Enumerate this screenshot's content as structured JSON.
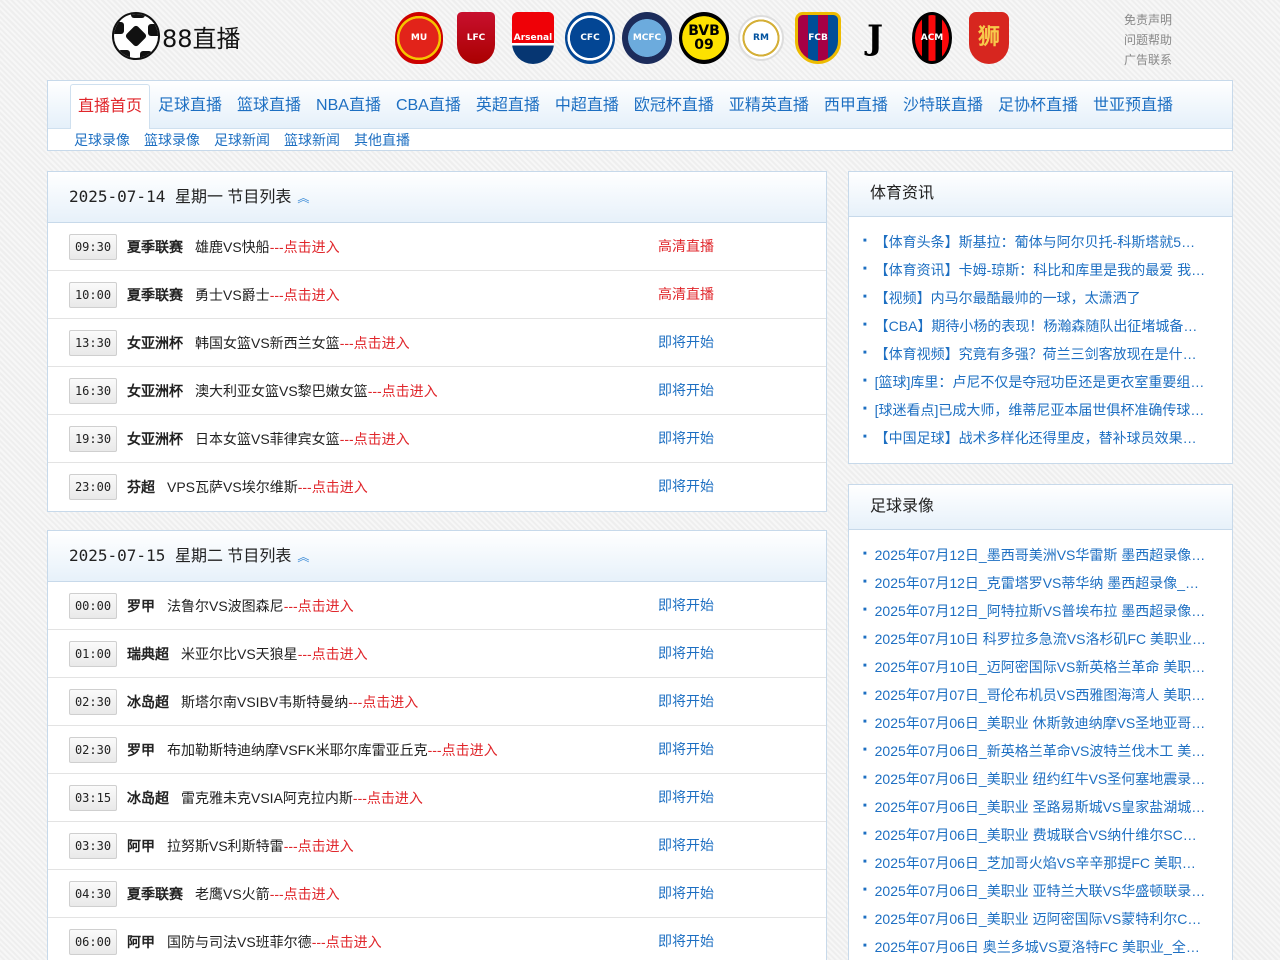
{
  "site": {
    "logo_text": "88直播"
  },
  "badges": [
    {
      "name": "manchester-united-crest-icon",
      "label": "MU",
      "cls": "c-mu"
    },
    {
      "name": "liverpool-crest-icon",
      "label": "LFC",
      "cls": "c-liv"
    },
    {
      "name": "arsenal-crest-icon",
      "label": "Arsenal",
      "cls": "c-ars"
    },
    {
      "name": "chelsea-crest-icon",
      "label": "CFC",
      "cls": "c-che"
    },
    {
      "name": "manchester-city-crest-icon",
      "label": "MCFC",
      "cls": "c-mci"
    },
    {
      "name": "dortmund-crest-icon",
      "label": "BVB 09",
      "cls": "c-bvb"
    },
    {
      "name": "real-madrid-crest-icon",
      "label": "RM",
      "cls": "c-rma"
    },
    {
      "name": "barcelona-crest-icon",
      "label": "FCB",
      "cls": "c-fcb"
    },
    {
      "name": "juventus-crest-icon",
      "label": "J",
      "cls": "c-juv"
    },
    {
      "name": "ac-milan-crest-icon",
      "label": "ACM",
      "cls": "c-mil"
    },
    {
      "name": "guangzhou-crest-icon",
      "label": "狮",
      "cls": "c-gz"
    }
  ],
  "toplinks": [
    "免责声明",
    "问题帮助",
    "广告联系"
  ],
  "nav": {
    "main": [
      "直播首页",
      "足球直播",
      "篮球直播",
      "NBA直播",
      "CBA直播",
      "英超直播",
      "中超直播",
      "欧冠杯直播",
      "亚精英直播",
      "西甲直播",
      "沙特联直播",
      "足协杯直播",
      "世亚预直播"
    ],
    "sub": [
      "足球录像",
      "篮球录像",
      "足球新闻",
      "篮球新闻",
      "其他直播"
    ]
  },
  "schedules": [
    {
      "date": "2025-07-14",
      "weekday": "星期一 节目列表",
      "rows": [
        {
          "time": "09:30",
          "league": "夏季联赛",
          "match": "雄鹿VS快船",
          "enter": "---点击进入",
          "status": "高清直播",
          "live": true
        },
        {
          "time": "10:00",
          "league": "夏季联赛",
          "match": "勇士VS爵士",
          "enter": "---点击进入",
          "status": "高清直播",
          "live": true
        },
        {
          "time": "13:30",
          "league": "女亚洲杯",
          "match": "韩国女篮VS新西兰女篮",
          "enter": "---点击进入",
          "status": "即将开始",
          "live": false
        },
        {
          "time": "16:30",
          "league": "女亚洲杯",
          "match": "澳大利亚女篮VS黎巴嫩女篮",
          "enter": "---点击进入",
          "status": "即将开始",
          "live": false
        },
        {
          "time": "19:30",
          "league": "女亚洲杯",
          "match": "日本女篮VS菲律宾女篮",
          "enter": "---点击进入",
          "status": "即将开始",
          "live": false
        },
        {
          "time": "23:00",
          "league": "芬超",
          "match": "VPS瓦萨VS埃尔维斯",
          "enter": "---点击进入",
          "status": "即将开始",
          "live": false
        }
      ]
    },
    {
      "date": "2025-07-15",
      "weekday": "星期二 节目列表",
      "rows": [
        {
          "time": "00:00",
          "league": "罗甲",
          "match": "法鲁尔VS波图森尼",
          "enter": "---点击进入",
          "status": "即将开始",
          "live": false
        },
        {
          "time": "01:00",
          "league": "瑞典超",
          "match": "米亚尔比VS天狼星",
          "enter": "---点击进入",
          "status": "即将开始",
          "live": false
        },
        {
          "time": "02:30",
          "league": "冰岛超",
          "match": "斯塔尔南VSIBV韦斯特曼纳",
          "enter": "---点击进入",
          "status": "即将开始",
          "live": false
        },
        {
          "time": "02:30",
          "league": "罗甲",
          "match": "布加勒斯特迪纳摩VSFK米耶尔库雷亚丘克",
          "enter": "---点击进入",
          "status": "即将开始",
          "live": false
        },
        {
          "time": "03:15",
          "league": "冰岛超",
          "match": "雷克雅未克VSIA阿克拉内斯",
          "enter": "---点击进入",
          "status": "即将开始",
          "live": false
        },
        {
          "time": "03:30",
          "league": "阿甲",
          "match": "拉努斯VS利斯特雷",
          "enter": "---点击进入",
          "status": "即将开始",
          "live": false
        },
        {
          "time": "04:30",
          "league": "夏季联赛",
          "match": "老鹰VS火箭",
          "enter": "---点击进入",
          "status": "即将开始",
          "live": false
        },
        {
          "time": "06:00",
          "league": "阿甲",
          "match": "国防与司法VS班菲尔德",
          "enter": "---点击进入",
          "status": "即将开始",
          "live": false
        }
      ]
    }
  ],
  "news": {
    "title": "体育资讯",
    "items": [
      "【体育头条】斯基拉：葡体与阿尔贝托-科斯塔就5…",
      "【体育资讯】卡姆-琼斯：科比和库里是我的最爱 我…",
      "【视频】内马尔最酷最帅的一球，太潇洒了",
      "【CBA】期待小杨的表现！杨瀚森随队出征堵城备…",
      "【体育视频】究竟有多强？荷兰三剑客放现在是什…",
      "[篮球]库里：卢尼不仅是夺冠功臣还是更衣室重要组…",
      "[球迷看点]已成大师，维蒂尼亚本届世俱杯准确传球…",
      "【中国足球】战术多样化还得里皮，替补球员效果…"
    ]
  },
  "videos": {
    "title": "足球录像",
    "items": [
      "2025年07月12日_墨西哥美洲VS华雷斯 墨西超录像…",
      "2025年07月12日_克雷塔罗VS蒂华纳 墨西超录像_…",
      "2025年07月12日_阿特拉斯VS普埃布拉 墨西超录像…",
      "2025年07月10日 科罗拉多急流VS洛杉矶FC 美职业…",
      "2025年07月10日_迈阿密国际VS新英格兰革命 美职…",
      "2025年07月07日_哥伦布机员VS西雅图海湾人 美职…",
      "2025年07月06日_美职业 休斯敦迪纳摩VS圣地亚哥…",
      "2025年07月06日_新英格兰革命VS波特兰伐木工 美…",
      "2025年07月06日_美职业 纽约红牛VS圣何塞地震录…",
      "2025年07月06日_美职业 圣路易斯城VS皇家盐湖城…",
      "2025年07月06日_美职业 费城联合VS纳什维尔SC…",
      "2025年07月06日_芝加哥火焰VS辛辛那提FC 美职…",
      "2025年07月06日_美职业 亚特兰大联VS华盛顿联录…",
      "2025年07月06日_美职业 迈阿密国际VS蒙特利尔C…",
      "2025年07月06日 奥兰多城VS夏洛特FC 美职业_全…"
    ]
  }
}
